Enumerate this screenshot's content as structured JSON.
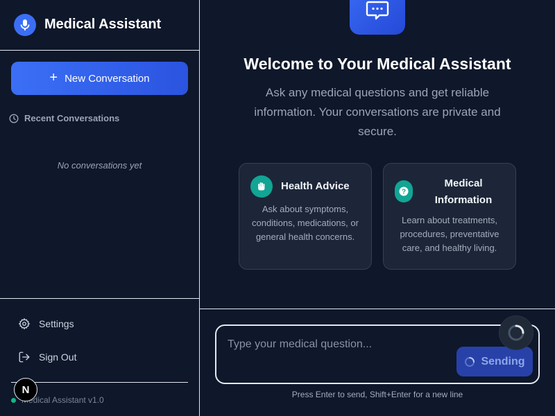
{
  "sidebar": {
    "app_title": "Medical Assistant",
    "new_conversation_label": "New Conversation",
    "recent_header": "Recent Conversations",
    "empty_text": "No conversations yet",
    "settings_label": "Settings",
    "sign_out_label": "Sign Out",
    "version": "Medical Assistant v1.0",
    "badge_letter": "N"
  },
  "main": {
    "welcome_title": "Welcome to Your Medical Assistant",
    "welcome_subtitle": "Ask any medical questions and get reliable information. Your conversations are private and secure.",
    "cards": [
      {
        "title": "Health Advice",
        "description": "Ask about symptoms, conditions, medications, or general health concerns.",
        "icon": "hand-icon"
      },
      {
        "title": "Medical Information",
        "description": "Learn about treatments, procedures, preventative care, and healthy living.",
        "icon": "question-icon"
      }
    ],
    "input": {
      "placeholder": "Type your medical question...",
      "send_label": "Sending"
    },
    "hint": "Press Enter to send, Shift+Enter for a new line"
  },
  "colors": {
    "background": "#0f172a",
    "accent": "#3b6ef5",
    "teal": "#12a594"
  }
}
